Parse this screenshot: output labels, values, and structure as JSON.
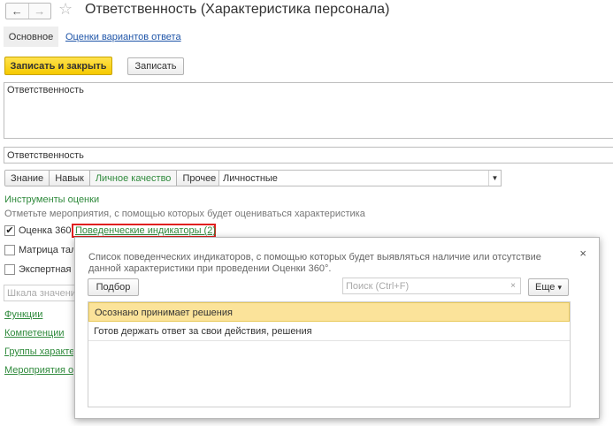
{
  "header": {
    "back_icon": "arrow-left-icon",
    "forward_icon": "arrow-right-icon",
    "favorite_icon": "star-icon",
    "title": "Ответственность (Характеристика персонала)"
  },
  "tabs": {
    "main": "Основное",
    "link": "Оценки вариантов ответа"
  },
  "toolbar": {
    "save_close": "Записать и закрыть",
    "save": "Записать"
  },
  "form": {
    "description": "Ответственность",
    "name": "Ответственность",
    "types": [
      "Знание",
      "Навык",
      "Личное качество",
      "Прочее"
    ],
    "type_active": "Личное качество",
    "category": "Личностные"
  },
  "tools": {
    "heading": "Инструменты оценки",
    "hint": "Отметьте мероприятия, с помощью которых будет оцениваться характеристика",
    "eval360_label": "Оценка 360",
    "eval360_check": "✔",
    "behavior_link": "Поведенческие индикаторы (2)",
    "matrix_label": "Матрица тала",
    "expert_label": "Экспертная о",
    "scale_placeholder": "Шкала значений"
  },
  "links": {
    "functions": "Функции",
    "competencies": "Компетенции",
    "groups": "Группы характер",
    "events": "Мероприятия обу"
  },
  "popup": {
    "description": "Список поведенческих индикаторов, с помощью которых будет выявляться наличие или отсутствие данной характеристики при проведении Оценки 360°.",
    "close": "×",
    "pick_button": "Подбор",
    "search_placeholder": "Поиск (Ctrl+F)",
    "search_clear": "×",
    "more_button": "Еще",
    "more_arrow": "▾",
    "items": [
      "Осознано принимает решения",
      "Готов держать ответ за свои действия, решения"
    ]
  },
  "colors": {
    "accent_green": "#2f8a3c",
    "link_blue": "#1f55a8",
    "primary_yellow": "#f5c900",
    "selection": "#fbe39a",
    "highlight_red": "#e02020"
  }
}
